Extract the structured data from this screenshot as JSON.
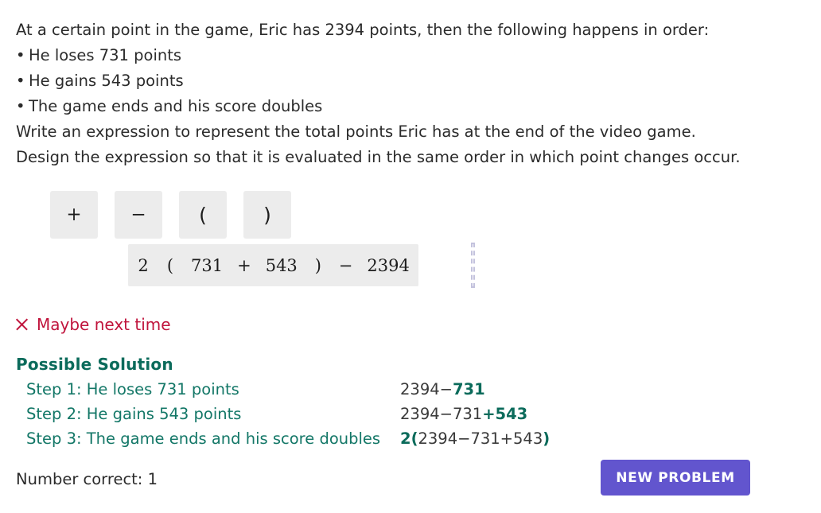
{
  "problem": {
    "intro": "At a certain point in the game, Eric has 2394 points, then the following happens in order:",
    "bullet_glyph": "•",
    "bullets": [
      "He loses 731 points",
      "He gains 543 points",
      "The game ends and his score doubles"
    ],
    "instruction_1": "Write an expression to represent the total points Eric has at the end of the video game.",
    "instruction_2": "Design the expression so that it is evaluated in the same order in which point changes occur."
  },
  "palette": {
    "tiles": [
      {
        "label": "+",
        "name": "plus"
      },
      {
        "label": "−",
        "name": "minus"
      },
      {
        "label": "(",
        "name": "open-paren"
      },
      {
        "label": ")",
        "name": "close-paren"
      }
    ]
  },
  "expression": {
    "tokens": [
      "2",
      "(",
      "731",
      "+",
      "543",
      ")",
      "−",
      "2394"
    ],
    "drop_target_visible": true,
    "drop_target_color": "#c3c2dd"
  },
  "feedback": {
    "icon": "x-icon",
    "text": "Maybe next time",
    "color": "#c0143c"
  },
  "solution": {
    "title": "Possible Solution",
    "title_color": "#0b6b5b",
    "step_color": "#137767",
    "rows": [
      {
        "label": "Step 1: He loses 731 points",
        "expr_plain_1": "2394−",
        "expr_highlight": "731",
        "expr_plain_2": ""
      },
      {
        "label": "Step 2: He gains 543 points",
        "expr_plain_1": "2394−731",
        "expr_highlight": "+543",
        "expr_plain_2": ""
      },
      {
        "label": "Step 3: The game ends and his score doubles",
        "expr_plain_1": "",
        "expr_highlight": "2(",
        "expr_plain_2": "2394−731+543",
        "expr_highlight_2": ")"
      }
    ]
  },
  "footer": {
    "score_label": "Number correct: 1",
    "new_problem_label": "NEW PROBLEM",
    "button_color": "#6255ce"
  }
}
